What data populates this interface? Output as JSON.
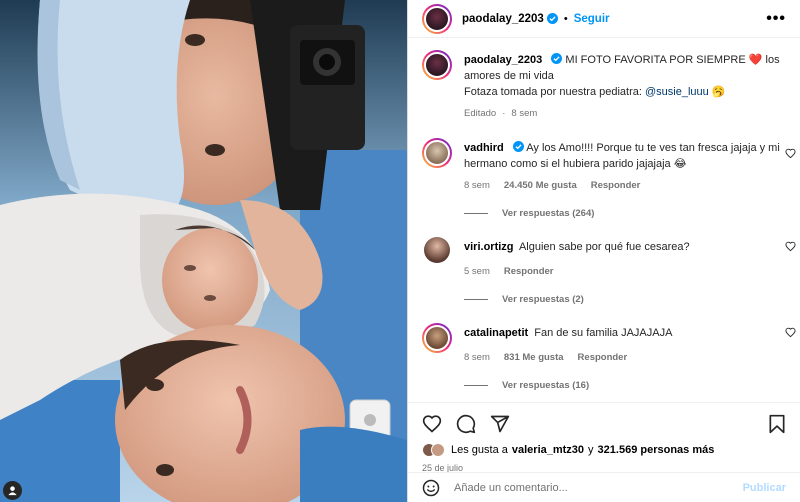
{
  "post": {
    "username": "paodalay_2203",
    "follow_label": "Seguir",
    "more_label": "•••",
    "separator": "•"
  },
  "caption": {
    "username": "paodalay_2203",
    "text_part1": "MI FOTO FAVORITA POR SIEMPRE",
    "heart": "❤️",
    "text_part2": "los amores de mi vida",
    "line2": "Fotaza tomada por nuestra pediatra:",
    "mention": "@susie_luuu",
    "emoji": "🥱",
    "edited": "Editado",
    "time": "8 sem"
  },
  "comments": [
    {
      "username": "vadhird",
      "verified": true,
      "text": "Ay los Amo!!!! Porque tu te ves tan fresca jajaja y mi hermano como si el hubiera parido jajajaja 😂",
      "time": "8 sem",
      "likes": "24.450 Me gusta",
      "reply": "Responder",
      "view_replies": "Ver respuestas (264)"
    },
    {
      "username": "viri.ortizg",
      "verified": false,
      "text": "Alguien sabe por qué fue cesarea?",
      "time": "5 sem",
      "likes": "",
      "reply": "Responder",
      "view_replies": "Ver respuestas (2)"
    },
    {
      "username": "catalinapetit",
      "verified": false,
      "text": "Fan de su familia JAJAJAJA",
      "time": "8 sem",
      "likes": "831 Me gusta",
      "reply": "Responder",
      "view_replies": "Ver respuestas (16)"
    }
  ],
  "likes": {
    "prefix": "Les gusta a",
    "user": "valeria_mtz30",
    "and": "y",
    "count": "321.569 personas más"
  },
  "date": "25 de julio",
  "add_comment": {
    "placeholder": "Añade un comentario...",
    "post_label": "Publicar"
  },
  "colors": {
    "link_blue": "#0095f6",
    "mention": "#00376b",
    "muted": "#737373"
  },
  "icons": [
    "heart-icon",
    "comment-icon",
    "share-icon",
    "bookmark-icon",
    "emoji-icon",
    "verified-icon",
    "more-icon",
    "user-tag-icon"
  ]
}
